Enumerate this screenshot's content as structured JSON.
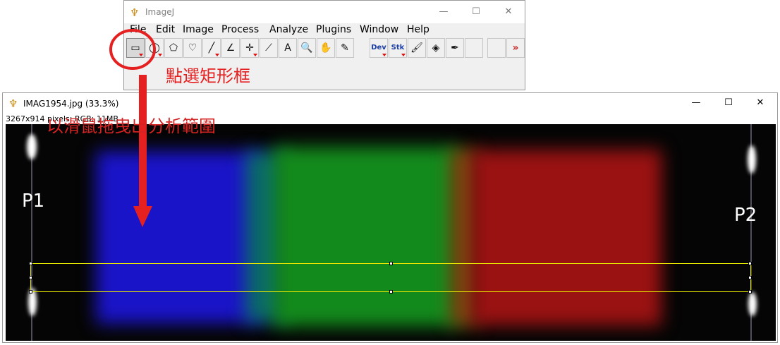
{
  "imagej_window": {
    "title": "ImageJ",
    "controls": {
      "minimize": "—",
      "maximize": "☐",
      "close": "✕"
    },
    "menu": [
      "File",
      "Edit",
      "Image",
      "Process",
      "Analyze",
      "Plugins",
      "Window",
      "Help"
    ],
    "tools": {
      "rectangle": "▭",
      "oval": "◯",
      "polygon": "⬠",
      "freehand": "♡",
      "line": "╱",
      "angle": "∠",
      "point": "✛",
      "wand": "⟋",
      "text": "A",
      "magnifier": "🔍",
      "scroll": "✋",
      "color_picker": "✎",
      "dev": "Dev",
      "stk": "Stk",
      "brush": "🖌",
      "flood_fill": "◈",
      "pencil": "✒",
      "more": "»"
    }
  },
  "annotations": {
    "select_rect": "點選矩形框",
    "drag_range": "以滑鼠拖曳出分析範圍",
    "p1": "P1",
    "p2": "P2"
  },
  "image_window": {
    "title": "IMAG1954.jpg (33.3%)",
    "info": "3267x914 pixels; RGB; 11MB",
    "controls": {
      "minimize": "—",
      "maximize": "☐",
      "close": "✕"
    }
  },
  "colors": {
    "annotation_red": "#e52020",
    "roi_yellow": "#e6e600"
  }
}
